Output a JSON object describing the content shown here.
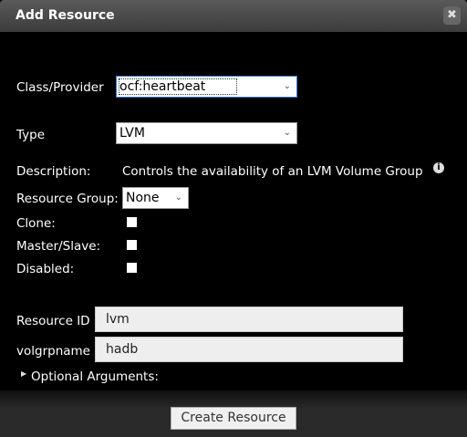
{
  "dialog": {
    "title": "Add Resource",
    "close_icon": "close-icon"
  },
  "form": {
    "class_provider": {
      "label": "Class/Provider",
      "value": "ocf:heartbeat"
    },
    "type": {
      "label": "Type",
      "value": "LVM"
    },
    "description": {
      "label": "Description:",
      "value": "Controls the availability of an LVM Volume Group",
      "icon": "info-icon"
    },
    "resource_group": {
      "label": "Resource Group:",
      "value": "None"
    },
    "clone": {
      "label": "Clone:",
      "checked": false
    },
    "master_slave": {
      "label": "Master/Slave:",
      "checked": false
    },
    "disabled": {
      "label": "Disabled:",
      "checked": false
    },
    "resource_id": {
      "label": "Resource ID",
      "value": "lvm"
    },
    "volgrpname": {
      "label": "volgrpname",
      "value": "hadb"
    },
    "optional_arguments": {
      "label": "Optional Arguments:",
      "expanded": false
    }
  },
  "footer": {
    "create_label": "Create Resource"
  }
}
